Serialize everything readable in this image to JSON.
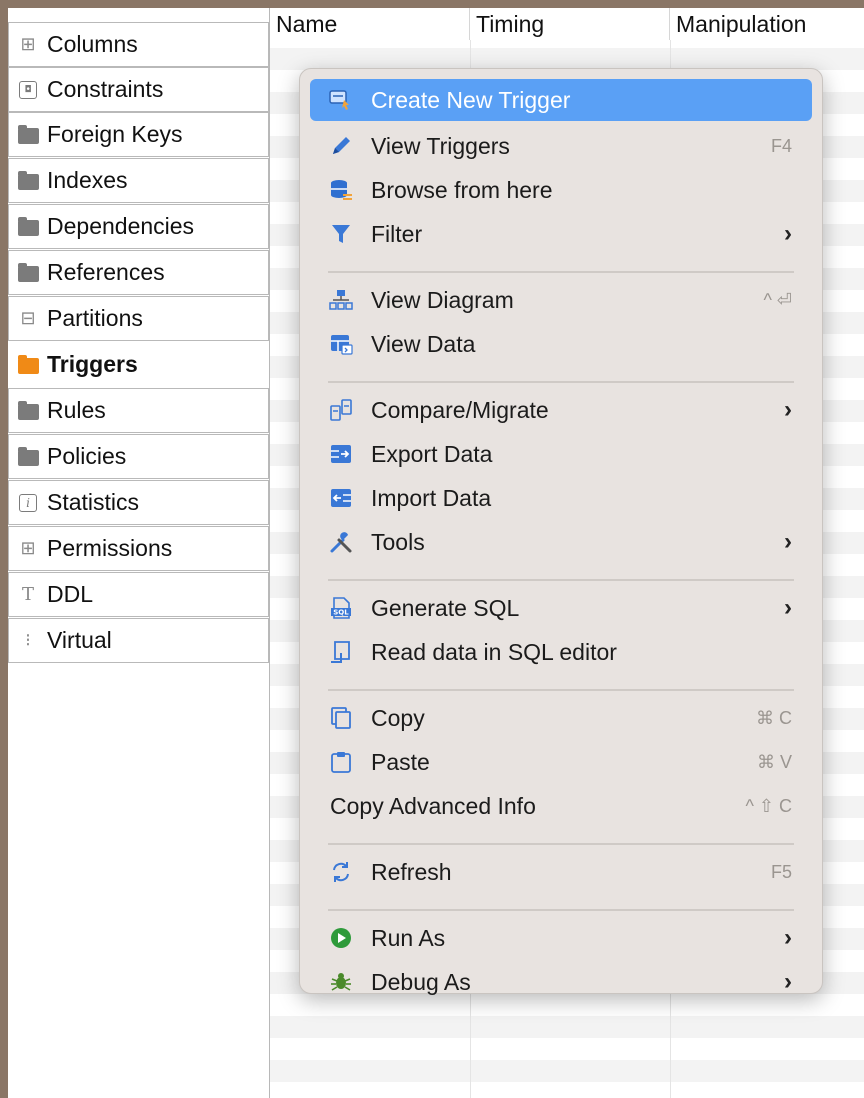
{
  "sidebar": {
    "items": [
      {
        "label": "Columns",
        "icon": "add-column-icon"
      },
      {
        "label": "Constraints",
        "icon": "key-icon"
      },
      {
        "label": "Foreign Keys",
        "icon": "folder-icon"
      },
      {
        "label": "Indexes",
        "icon": "folder-icon"
      },
      {
        "label": "Dependencies",
        "icon": "folder-icon"
      },
      {
        "label": "References",
        "icon": "folder-icon"
      },
      {
        "label": "Partitions",
        "icon": "partition-icon"
      },
      {
        "label": "Triggers",
        "icon": "folder-icon",
        "active": true
      },
      {
        "label": "Rules",
        "icon": "folder-icon"
      },
      {
        "label": "Policies",
        "icon": "folder-icon"
      },
      {
        "label": "Statistics",
        "icon": "info-icon"
      },
      {
        "label": "Permissions",
        "icon": "permissions-icon"
      },
      {
        "label": "DDL",
        "icon": "ddl-icon"
      },
      {
        "label": "Virtual",
        "icon": "virtual-icon"
      }
    ]
  },
  "table": {
    "columns": [
      "Name",
      "Timing",
      "Manipulation"
    ]
  },
  "menu": {
    "items": [
      {
        "label": "Create New Trigger",
        "icon": "create-trigger-icon",
        "highlighted": true
      },
      {
        "label": "View Triggers",
        "icon": "pencil-icon",
        "shortcut": "F4"
      },
      {
        "label": "Browse from here",
        "icon": "browse-database-icon"
      },
      {
        "label": "Filter",
        "icon": "filter-icon",
        "submenu": true
      },
      {
        "label": "View Diagram",
        "icon": "diagram-icon",
        "shortcut": "^ ⏎"
      },
      {
        "label": "View Data",
        "icon": "view-data-icon"
      },
      {
        "label": "Compare/Migrate",
        "icon": "compare-icon",
        "submenu": true
      },
      {
        "label": "Export Data",
        "icon": "export-icon"
      },
      {
        "label": "Import Data",
        "icon": "import-icon"
      },
      {
        "label": "Tools",
        "icon": "tools-icon",
        "submenu": true
      },
      {
        "label": "Generate SQL",
        "icon": "sql-icon",
        "submenu": true
      },
      {
        "label": "Read data in SQL editor",
        "icon": "sql-editor-icon"
      },
      {
        "label": "Copy",
        "icon": "copy-icon",
        "shortcut": "⌘ C"
      },
      {
        "label": "Paste",
        "icon": "paste-icon",
        "shortcut": "⌘ V"
      },
      {
        "label": "Copy Advanced Info",
        "icon": "",
        "shortcut": "^ ⇧ C"
      },
      {
        "label": "Refresh",
        "icon": "refresh-icon",
        "shortcut": "F5"
      },
      {
        "label": "Run As",
        "icon": "run-icon",
        "submenu": true
      },
      {
        "label": "Debug As",
        "icon": "debug-icon",
        "submenu": true
      }
    ],
    "submenu_glyph": "›"
  }
}
